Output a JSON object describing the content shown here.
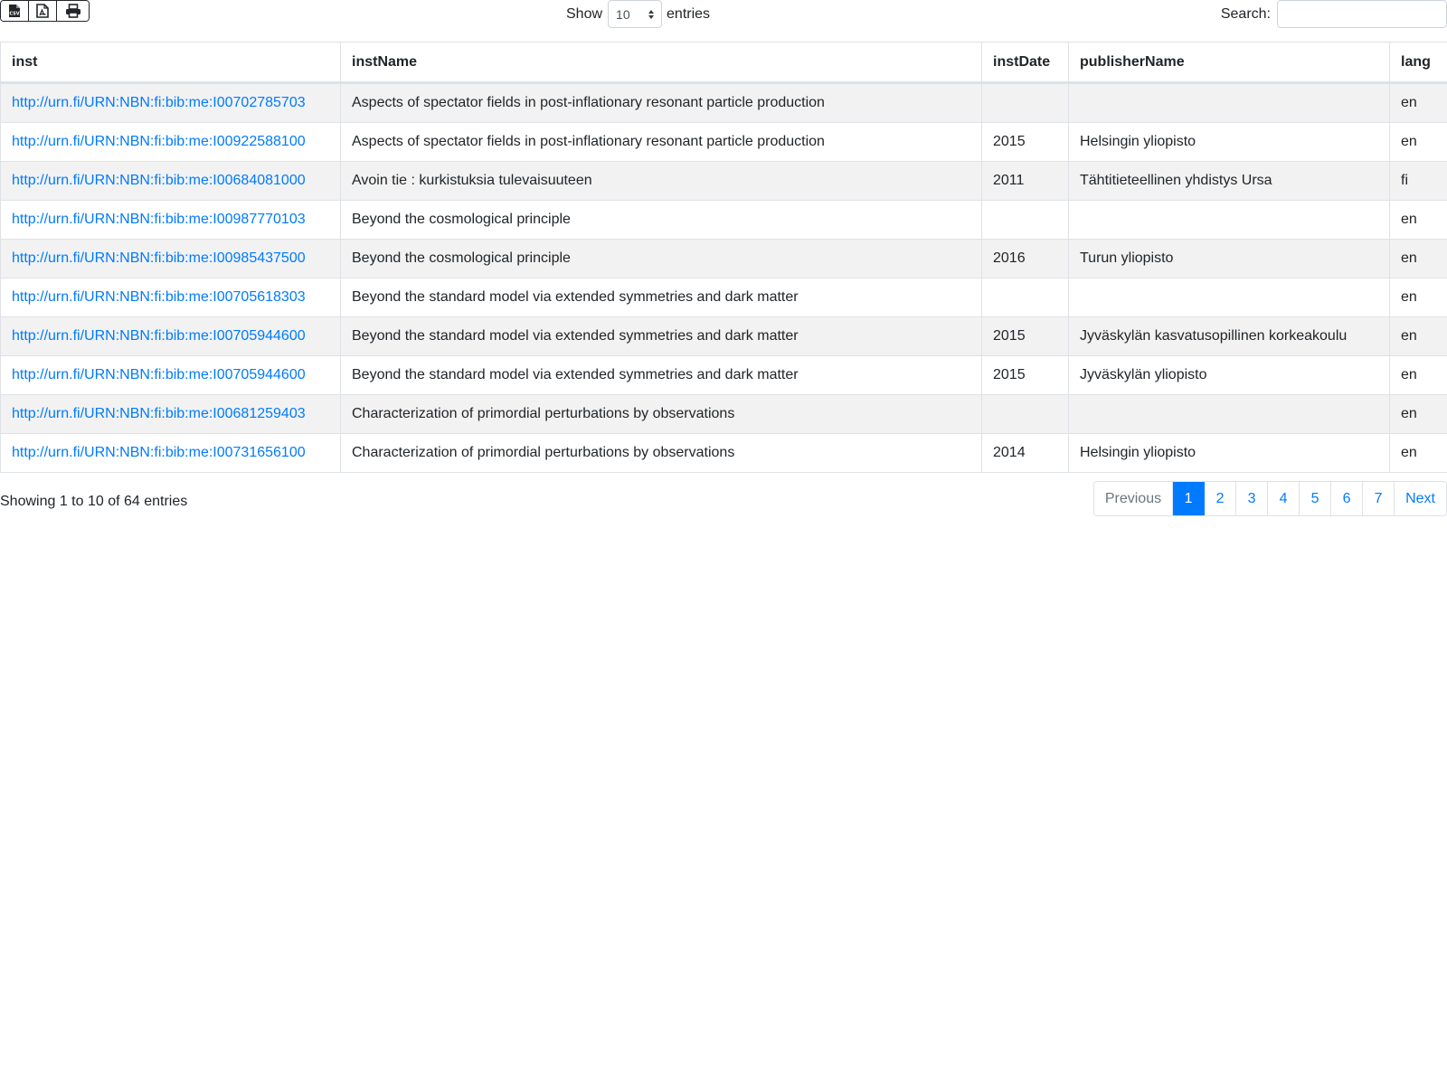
{
  "toolbar": {
    "export_buttons": [
      {
        "name": "csv-export-button",
        "icon": "file-csv-icon"
      },
      {
        "name": "pdf-export-button",
        "icon": "file-pdf-icon"
      },
      {
        "name": "print-button",
        "icon": "print-icon"
      }
    ]
  },
  "length_control": {
    "show_label": "Show",
    "selected_value": "10",
    "entries_label": "entries"
  },
  "search": {
    "label": "Search:",
    "value": "",
    "placeholder": ""
  },
  "table": {
    "columns": [
      "inst",
      "instName",
      "instDate",
      "publisherName",
      "lang"
    ],
    "rows": [
      {
        "inst": "http://urn.fi/URN:NBN:fi:bib:me:I00702785703",
        "instName": "Aspects of spectator fields in post-inflationary resonant particle production",
        "instDate": "",
        "publisherName": "",
        "lang": "en"
      },
      {
        "inst": "http://urn.fi/URN:NBN:fi:bib:me:I00922588100",
        "instName": "Aspects of spectator fields in post-inflationary resonant particle production",
        "instDate": "2015",
        "publisherName": "Helsingin yliopisto",
        "lang": "en"
      },
      {
        "inst": "http://urn.fi/URN:NBN:fi:bib:me:I00684081000",
        "instName": "Avoin tie : kurkistuksia tulevaisuuteen",
        "instDate": "2011",
        "publisherName": "Tähtitieteellinen yhdistys Ursa",
        "lang": "fi"
      },
      {
        "inst": "http://urn.fi/URN:NBN:fi:bib:me:I00987770103",
        "instName": "Beyond the cosmological principle",
        "instDate": "",
        "publisherName": "",
        "lang": "en"
      },
      {
        "inst": "http://urn.fi/URN:NBN:fi:bib:me:I00985437500",
        "instName": "Beyond the cosmological principle",
        "instDate": "2016",
        "publisherName": "Turun yliopisto",
        "lang": "en"
      },
      {
        "inst": "http://urn.fi/URN:NBN:fi:bib:me:I00705618303",
        "instName": "Beyond the standard model via extended symmetries and dark matter",
        "instDate": "",
        "publisherName": "",
        "lang": "en"
      },
      {
        "inst": "http://urn.fi/URN:NBN:fi:bib:me:I00705944600",
        "instName": "Beyond the standard model via extended symmetries and dark matter",
        "instDate": "2015",
        "publisherName": "Jyväskylän kasvatusopillinen korkeakoulu",
        "lang": "en"
      },
      {
        "inst": "http://urn.fi/URN:NBN:fi:bib:me:I00705944600",
        "instName": "Beyond the standard model via extended symmetries and dark matter",
        "instDate": "2015",
        "publisherName": "Jyväskylän yliopisto",
        "lang": "en"
      },
      {
        "inst": "http://urn.fi/URN:NBN:fi:bib:me:I00681259403",
        "instName": "Characterization of primordial perturbations by observations",
        "instDate": "",
        "publisherName": "",
        "lang": "en"
      },
      {
        "inst": "http://urn.fi/URN:NBN:fi:bib:me:I00731656100",
        "instName": "Characterization of primordial perturbations by observations",
        "instDate": "2014",
        "publisherName": "Helsingin yliopisto",
        "lang": "en"
      }
    ]
  },
  "info": {
    "text": "Showing 1 to 10 of 64 entries"
  },
  "pagination": {
    "previous": "Previous",
    "pages": [
      "1",
      "2",
      "3",
      "4",
      "5",
      "6",
      "7"
    ],
    "active_page": "1",
    "next": "Next"
  },
  "colors": {
    "link": "#007bff",
    "active_page_bg": "#007bff",
    "stripe": "#f2f2f2",
    "border": "#dee2e6"
  }
}
